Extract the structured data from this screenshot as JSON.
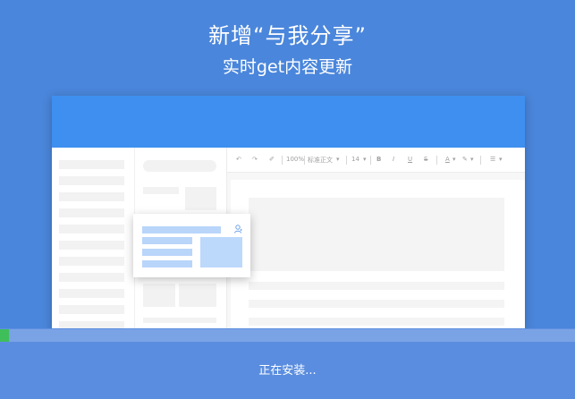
{
  "header": {
    "title": "新增“与我分享”",
    "subtitle": "实时get内容更新"
  },
  "mockup": {
    "toolbar": {
      "undo_icon": "undo-icon",
      "redo_icon": "redo-icon",
      "format_painter_icon": "format-painter-icon",
      "zoom": "100%",
      "style": "标准正文",
      "font_size": "14",
      "bold": "B",
      "italic": "I",
      "underline": "U",
      "strikethrough": "S",
      "font_color": "A",
      "highlight_icon": "highlight-icon",
      "align_icon": "align-icon"
    },
    "share_popup_icon": "person-icon"
  },
  "progress": {
    "fraction": 0.015
  },
  "status": {
    "text": "正在安装..."
  },
  "colors": {
    "background": "#4a86db",
    "mock_header": "#3e8fef",
    "progress_fill": "#3fbf5a",
    "bottom_bar": "#5a8ddf"
  }
}
